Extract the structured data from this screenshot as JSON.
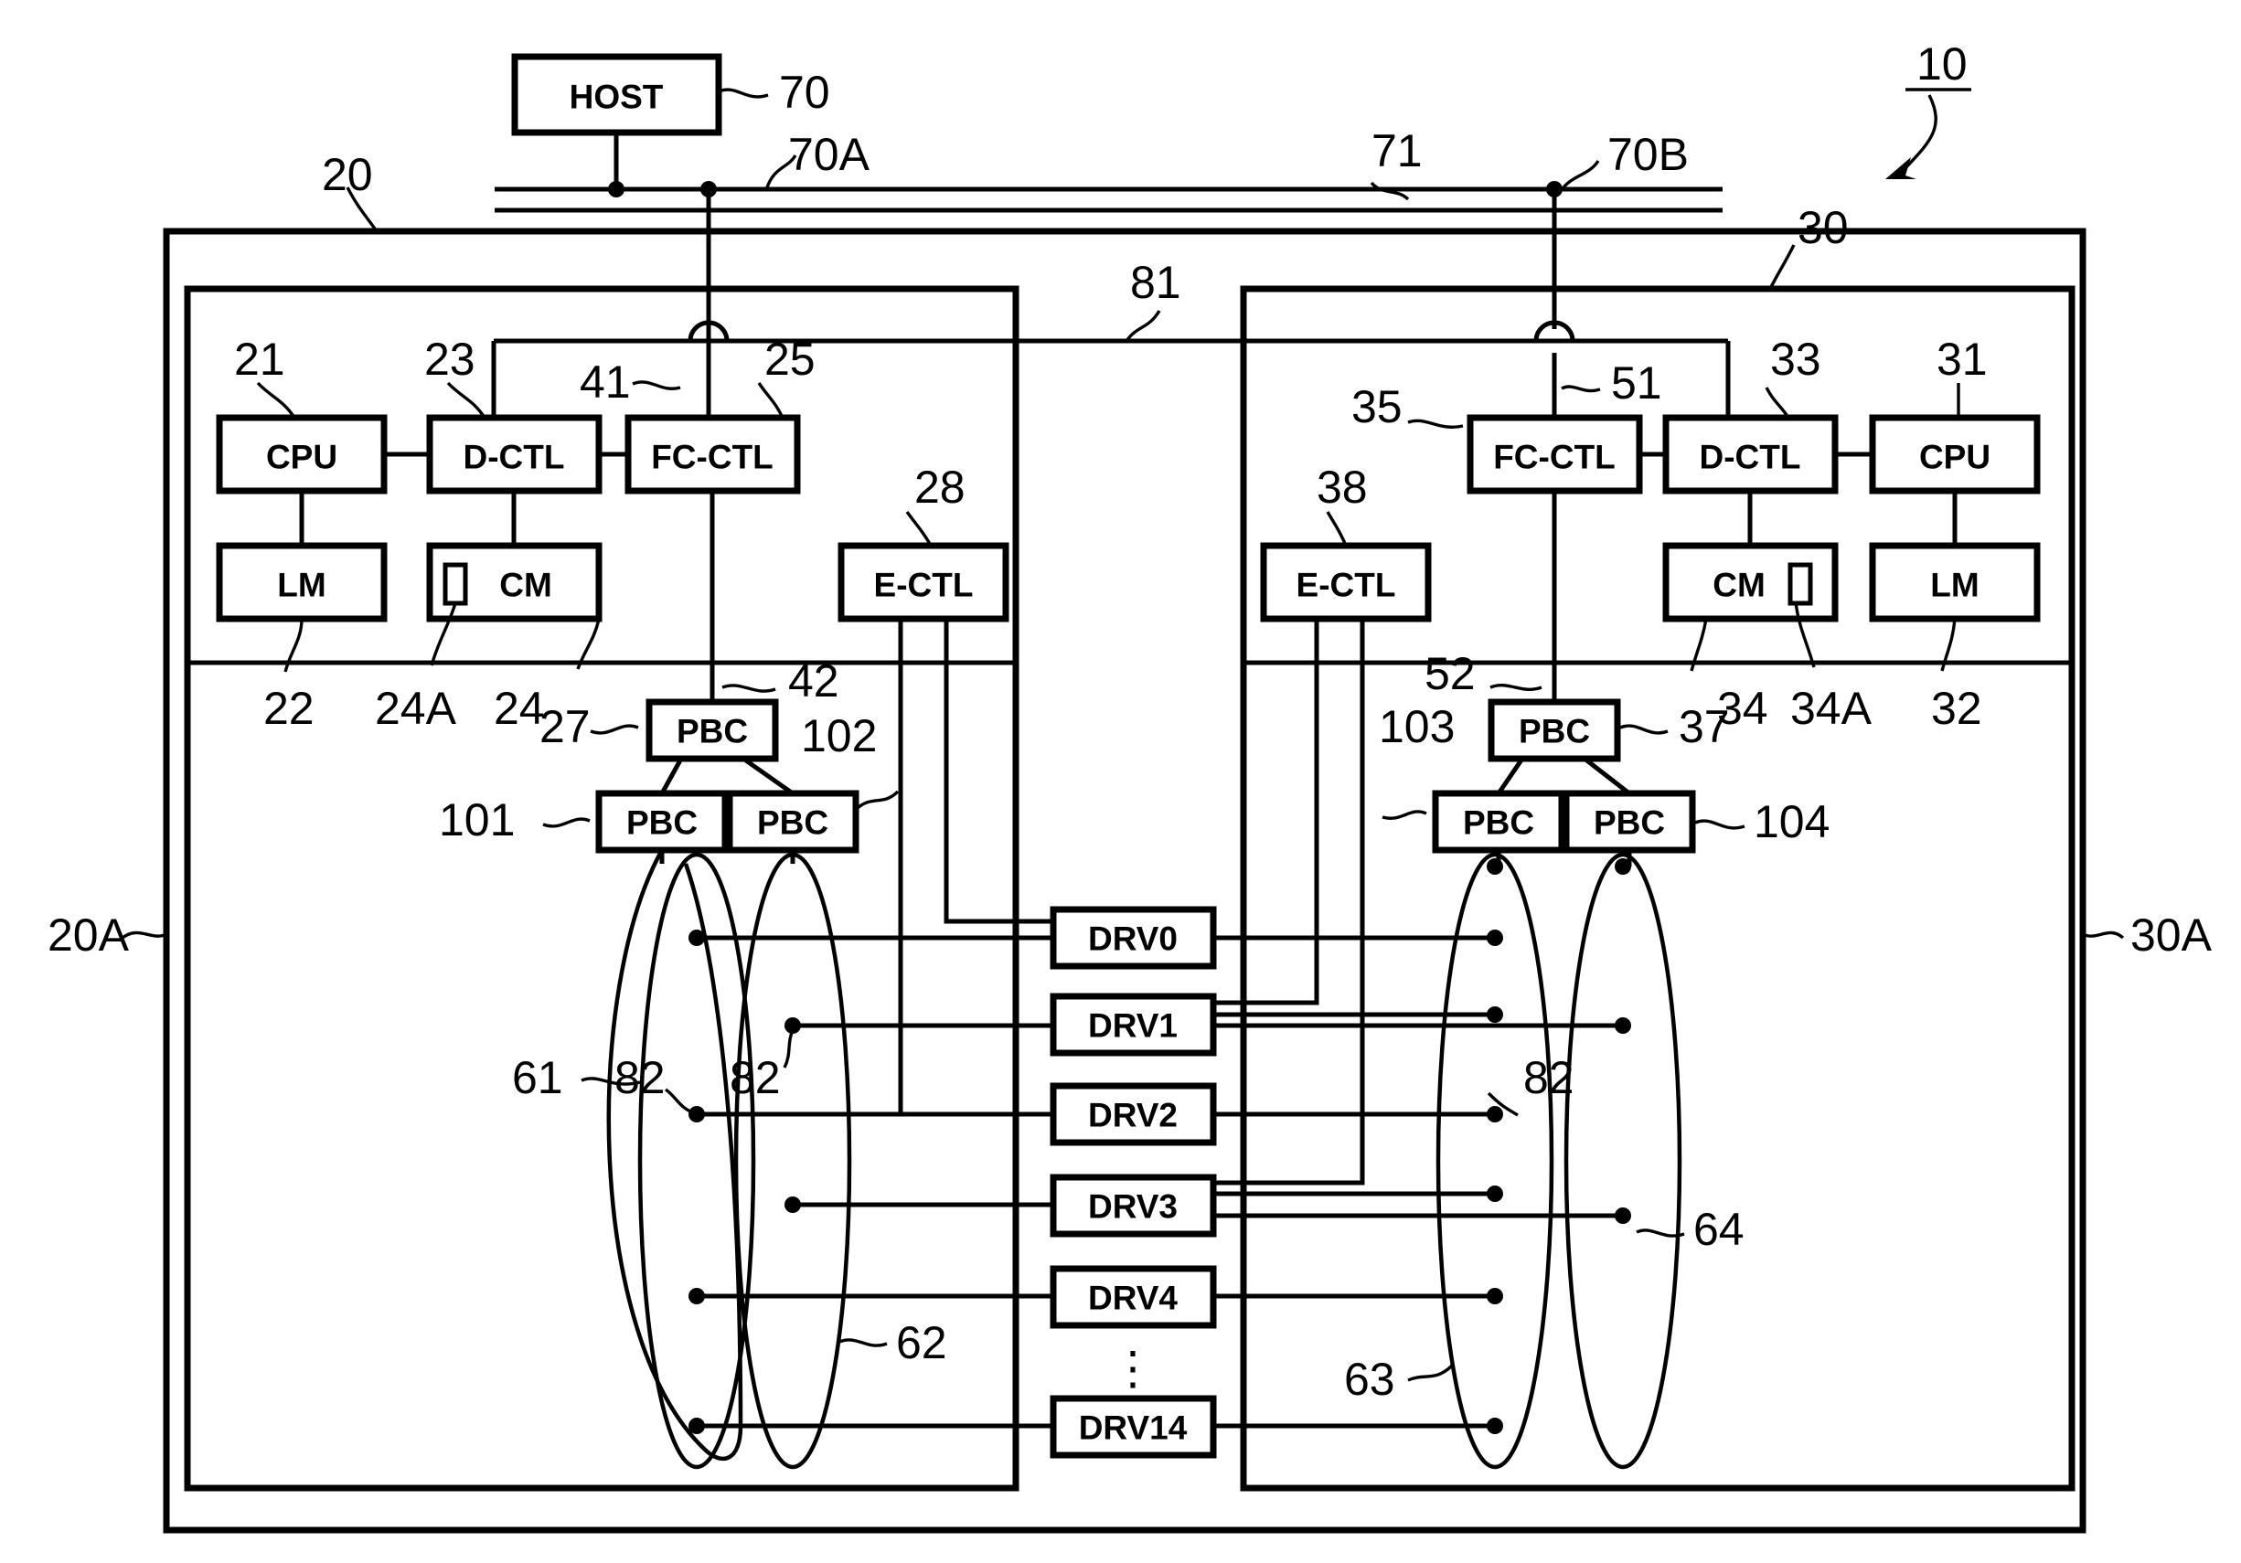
{
  "figure": {
    "type": "patent-block-diagram",
    "figure_id": "10",
    "background": "#ffffff",
    "ink": "#000000"
  },
  "blocks": {
    "host": "HOST",
    "cpu_left": "CPU",
    "dctl_left": "D-CTL",
    "fcctl_left": "FC-CTL",
    "lm_left": "LM",
    "cm_left": "CM",
    "ectl_left": "E-CTL",
    "pbc_left_top": "PBC",
    "pbc_left_a": "PBC",
    "pbc_left_b": "PBC",
    "cpu_right": "CPU",
    "dctl_right": "D-CTL",
    "fcctl_right": "FC-CTL",
    "lm_right": "LM",
    "cm_right": "CM",
    "ectl_right": "E-CTL",
    "pbc_right_top": "PBC",
    "pbc_right_a": "PBC",
    "pbc_right_b": "PBC"
  },
  "drives": [
    {
      "label": "DRV0"
    },
    {
      "label": "DRV1"
    },
    {
      "label": "DRV2"
    },
    {
      "label": "DRV3"
    },
    {
      "label": "DRV4"
    },
    {
      "label": "DRV14"
    }
  ],
  "ellipsis": "⋮",
  "reference_numerals": {
    "n10": "10",
    "n20": "20",
    "n20A": "20A",
    "n21": "21",
    "n22": "22",
    "n23": "23",
    "n24": "24",
    "n24A": "24A",
    "n25": "25",
    "n27": "27",
    "n28": "28",
    "n30": "30",
    "n30A": "30A",
    "n31": "31",
    "n32": "32",
    "n33": "33",
    "n34": "34",
    "n34A": "34A",
    "n35": "35",
    "n37": "37",
    "n38": "38",
    "n41": "41",
    "n42": "42",
    "n51": "51",
    "n52": "52",
    "n61": "61",
    "n62": "62",
    "n63": "63",
    "n64": "64",
    "n70": "70",
    "n70A": "70A",
    "n70B": "70B",
    "n71": "71",
    "n81": "81",
    "n82_a": "82",
    "n82_b": "82",
    "n82_c": "82",
    "n101": "101",
    "n102": "102",
    "n103": "103",
    "n104": "104"
  }
}
